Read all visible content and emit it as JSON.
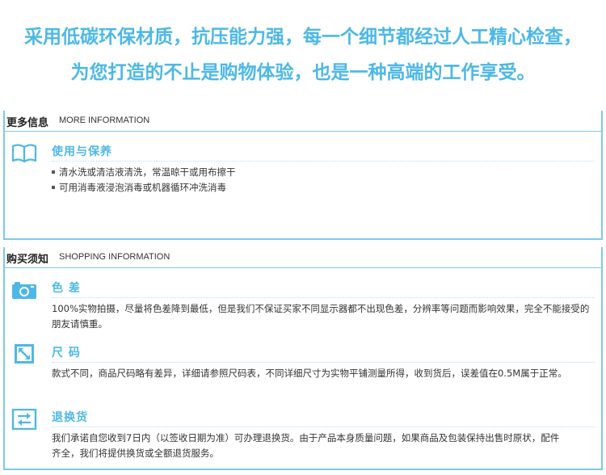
{
  "hero": {
    "line1": "采用低碳环保材质，抗压能力强，每一个细节都经过人工精心检查，",
    "line2": "为您打造的不止是购物体验，也是一种高端的工作享受。"
  },
  "more_info": {
    "title_cn": "更多信息",
    "title_en": "MORE INFORMATION",
    "usage": {
      "icon": "open-book-icon",
      "title": "使用与保养",
      "bullets": [
        "清水洗或清洁液清洗，常温晾干或用布擦干",
        "可用消毒液浸泡消毒或机器循环冲洗消毒"
      ]
    }
  },
  "shopping_info": {
    "title_cn": "购买须知",
    "title_en": "SHOPPING INFORMATION",
    "color": {
      "icon": "camera-icon",
      "title": "色 差",
      "text": "100%实物拍摄，尽量将色差降到最低，但是我们不保证买家不同显示器都不出现色差，分辨率等问题而影响效果，完全不能接受的朋友请慎重。"
    },
    "size": {
      "icon": "resize-icon",
      "title": "尺 码",
      "text": "款式不同，商品尺码略有差异，详细请参照尺码表，不同详细尺寸为实物平铺测量所得，收到货后，误差值在0.5M属于正常。"
    },
    "returns": {
      "icon": "exchange-icon",
      "title": "退换货",
      "text": "我们承诺自您收到7日内（以签收日期为准）可办理退换货。由于产品本身质量问题，如果商品及包装保持出售时原状，配件齐全，我们将提供换货或全额退货服务。"
    }
  },
  "colors": {
    "accent": "#4db8e6",
    "border": "#7cc8ea"
  }
}
